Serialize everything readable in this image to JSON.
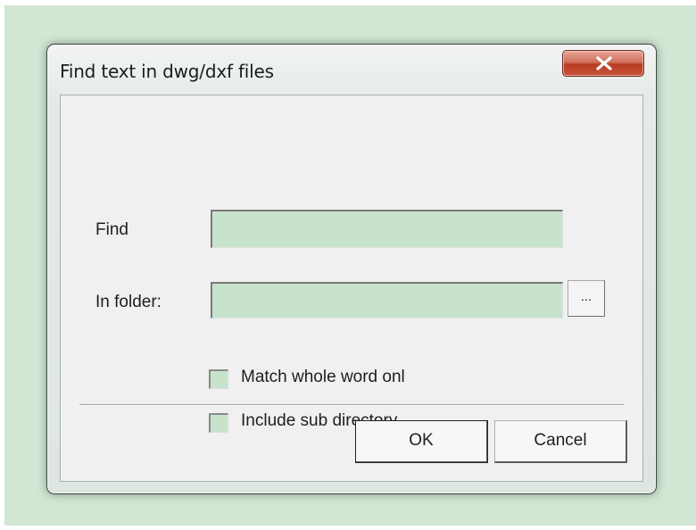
{
  "dialog": {
    "title": "Find text in dwg/dxf files",
    "close_symbol": "x"
  },
  "form": {
    "find_label": "Find",
    "find_value": "",
    "folder_label": "In folder:",
    "folder_value": "",
    "browse_label": "..."
  },
  "options": {
    "match_whole_word_label": "Match whole word onl",
    "match_whole_word_checked": false,
    "include_sub_directory_label": "Include sub directory",
    "include_sub_directory_checked": false
  },
  "buttons": {
    "ok_label": "OK",
    "cancel_label": "Cancel"
  },
  "colors": {
    "backdrop": "#d2e6d4",
    "field_fill": "#c8e3cc",
    "close_button": "#c7553b"
  }
}
